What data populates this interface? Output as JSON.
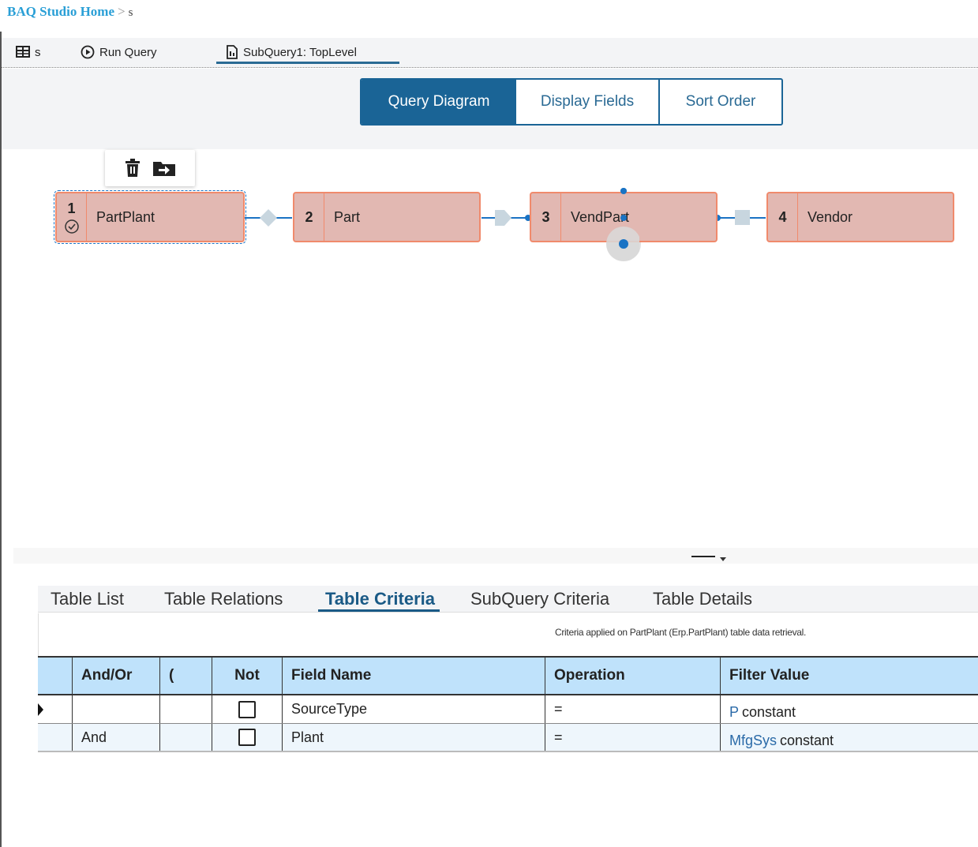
{
  "breadcrumb": {
    "home": "BAQ Studio Home",
    "separator": ">",
    "current": "s"
  },
  "toolbar": {
    "query_name": "s",
    "run_query": "Run Query",
    "subquery_tab": "SubQuery1: TopLevel"
  },
  "view_tabs": {
    "query_diagram": "Query Diagram",
    "display_fields": "Display Fields",
    "sort_order": "Sort Order",
    "active": "Query Diagram"
  },
  "diagram": {
    "nodes": [
      {
        "num": "1",
        "label": "PartPlant",
        "selected": true
      },
      {
        "num": "2",
        "label": "Part"
      },
      {
        "num": "3",
        "label": "VendPart"
      },
      {
        "num": "4",
        "label": "Vendor"
      }
    ],
    "node_toolbar_icons": [
      "trash-icon",
      "move-out-icon"
    ]
  },
  "bottom_tabs": {
    "items": [
      "Table List",
      "Table Relations",
      "Table Criteria",
      "SubQuery Criteria",
      "Table Details"
    ],
    "active": "Table Criteria"
  },
  "criteria_note": "Criteria applied on PartPlant (Erp.PartPlant) table data retrieval.",
  "grid": {
    "columns": [
      "And/Or",
      "(",
      "Not",
      "Field Name",
      "Operation",
      "Filter Value"
    ],
    "rows": [
      {
        "and_or": "",
        "paren": "",
        "not": false,
        "field": "SourceType",
        "op": "=",
        "value": "P",
        "value_suffix": "constant"
      },
      {
        "and_or": "And",
        "paren": "",
        "not": false,
        "field": "Plant",
        "op": "=",
        "value": "MfgSys",
        "value_suffix": "constant"
      }
    ]
  },
  "colors": {
    "accent": "#1a6496",
    "node_fill": "#e2b8b2",
    "node_border": "#f08a6c",
    "grid_header": "#bfe2fb",
    "connector": "#1a73c4"
  }
}
